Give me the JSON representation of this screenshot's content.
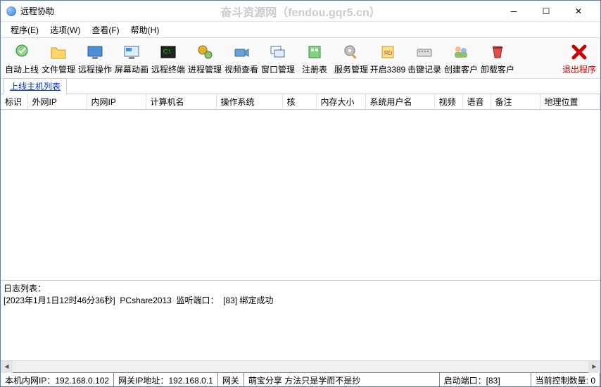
{
  "window": {
    "title": "远程协助",
    "watermark": "奋斗资源网（fendou.gqr5.cn）"
  },
  "menu": {
    "program": "程序(E)",
    "options": "选项(W)",
    "view": "查看(F)",
    "help": "帮助(H)"
  },
  "toolbar": {
    "auto_online": "自动上线",
    "file_mgr": "文件管理",
    "remote_op": "远程操作",
    "screen_anim": "屏幕动画",
    "remote_term": "远程终端",
    "proc_mgr": "进程管理",
    "video_view": "视频查看",
    "window_mgr": "窗口管理",
    "registry": "注册表",
    "svc_mgr": "服务管理",
    "open_3389": "开启3389",
    "keylog": "击键记录",
    "create_client": "创建客户",
    "uninstall": "卸载客户",
    "exit": "退出程序"
  },
  "tabs": {
    "online_hosts": "上线主机列表"
  },
  "columns": {
    "flag": "标识",
    "wan_ip": "外网IP",
    "lan_ip": "内网IP",
    "computer": "计算机名",
    "os": "操作系统",
    "cores": "核",
    "mem": "内存大小",
    "sysuser": "系统用户名",
    "video": "视频",
    "voice": "语音",
    "note": "备注",
    "geo": "地理位置"
  },
  "log": {
    "header": "日志列表：",
    "line1": "[2023年1月1日12时46分36秒]  PCshare2013  监听端口：  [83] 绑定成功"
  },
  "status": {
    "lan_ip_label": "本机内网IP：",
    "lan_ip_value": "192.168.0.102",
    "gw_ip_label": "网关IP地址：",
    "gw_ip_value": "192.168.0.1",
    "gw_name_label": "网关",
    "slogan": "萌宝分享   方法只是学而不是抄",
    "port_label": "启动端口：",
    "port_value": "[83]",
    "count_label": "当前控制数量:",
    "count_value": "0"
  }
}
